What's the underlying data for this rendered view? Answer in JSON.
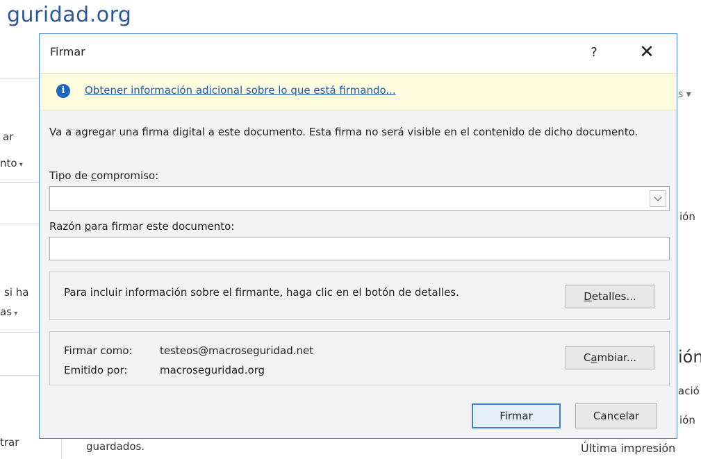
{
  "background": {
    "site_title": "guridad.org",
    "left_fragments": [
      "ar",
      "nto",
      "si ha",
      "as",
      "trar"
    ],
    "right_fragments": [
      "ión",
      "ión",
      "ació",
      "ión"
    ],
    "bottom_text": "guardados.",
    "bottom_right_text": "Última impresión"
  },
  "dialog": {
    "title": "Firmar",
    "help_label": "?",
    "close_label": "✕",
    "info_link": "Obtener información adicional sobre lo que está firmando...",
    "description": "Va a agregar una firma digital a este documento. Esta firma no será visible en el contenido de dicho documento.",
    "commitment_label_pre": "Tipo de ",
    "commitment_label_key": "c",
    "commitment_label_post": "ompromiso:",
    "commitment_value": "",
    "reason_label_pre": "Razón ",
    "reason_label_key": "p",
    "reason_label_post": "ara firmar este documento:",
    "reason_value": "",
    "details_text": "Para incluir información sobre el firmante, haga clic en el botón de detalles.",
    "details_button_key": "D",
    "details_button_rest": "etalles...",
    "sign_as_label": "Firmar como:",
    "sign_as_value": "testeos@macroseguridad.net",
    "issued_by_label": "Emitido por:",
    "issued_by_value": "macroseguridad.org",
    "change_button_pre": "C",
    "change_button_key": "a",
    "change_button_post": "mbiar...",
    "sign_button": "Firmar",
    "cancel_button": "Cancelar"
  },
  "colors": {
    "accent": "#3c7fd3",
    "info_bar": "#fffcdf",
    "link": "#1b5cb5",
    "brand": "#2b579a"
  }
}
